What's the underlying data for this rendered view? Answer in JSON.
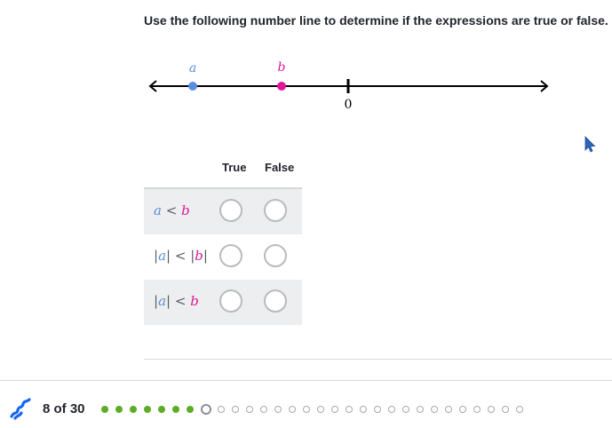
{
  "question": {
    "prompt": "Use the following number line to determine if the expressions are true or false."
  },
  "number_line": {
    "point_a_label": "a",
    "point_b_label": "b",
    "zero_label": "0",
    "point_a_color": "#5a8fe0",
    "point_b_color": "#e0169b"
  },
  "table": {
    "col_true": "True",
    "col_false": "False",
    "rows": [
      {
        "left_abs": false,
        "left": "a",
        "op": "<",
        "right_abs": false,
        "right": "b",
        "true_selected": false,
        "false_selected": false
      },
      {
        "left_abs": true,
        "left": "a",
        "op": "<",
        "right_abs": true,
        "right": "b",
        "true_selected": false,
        "false_selected": false
      },
      {
        "left_abs": true,
        "left": "a",
        "op": "<",
        "right_abs": false,
        "right": "b",
        "true_selected": false,
        "false_selected": false
      }
    ]
  },
  "footer": {
    "progress_text": "8 of 30",
    "completed": 7,
    "current": 8,
    "total": 30,
    "icon": "squiggle-icon",
    "done_color": "#5cac27"
  }
}
